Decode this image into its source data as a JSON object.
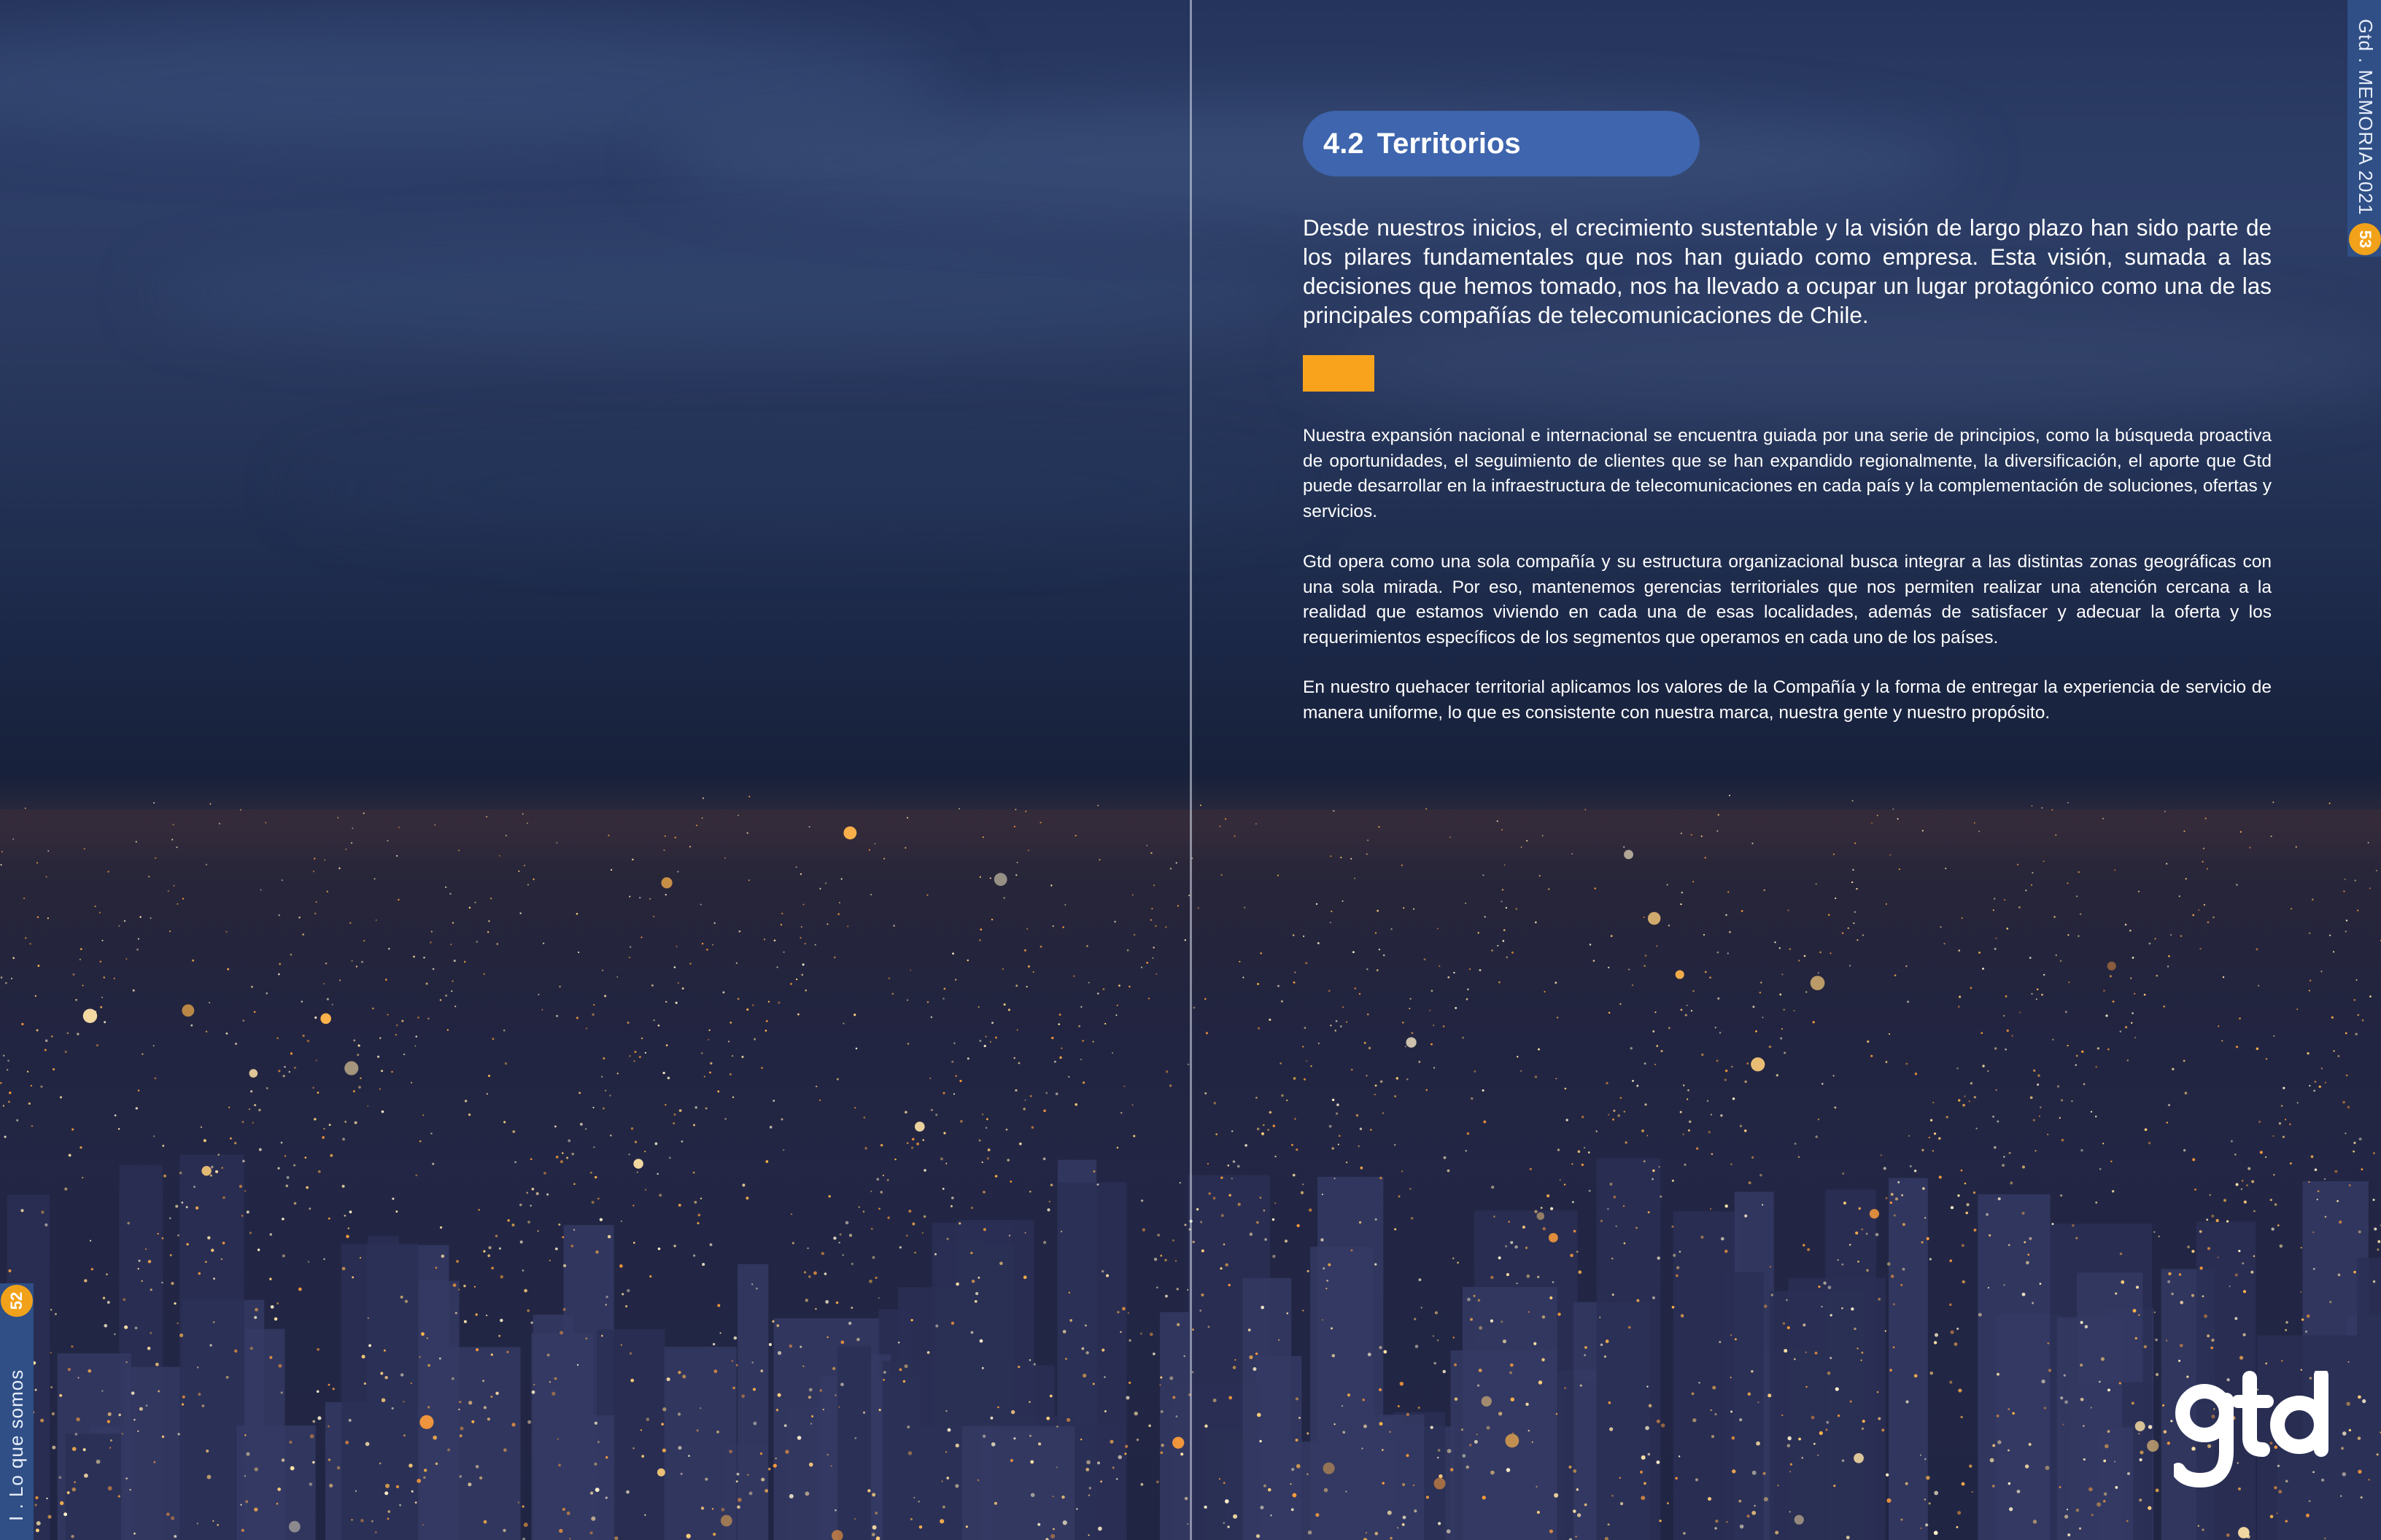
{
  "left_page": {
    "page_number": "52",
    "section_label": "I . Lo que somos"
  },
  "right_page": {
    "page_number": "53",
    "header_label": "Gtd . MEMORIA 2021",
    "section_number": "4.2",
    "section_title": "Territorios",
    "lead_paragraph": "Desde nuestros inicios, el crecimiento sustentable y la visión de largo plazo han sido parte de los pilares fundamentales que nos han guiado como empresa. Esta visión, sumada a las decisiones que hemos tomado, nos ha llevado a ocupar un lugar protagónico como una de las principales compañías de telecomunicaciones de Chile.",
    "paragraphs": [
      "Nuestra expansión nacional e internacional se encuentra guiada por una serie de principios, como la búsqueda proactiva de oportunidades, el seguimiento de clientes que se han expandido regionalmente, la diversificación, el aporte que Gtd puede desarrollar en la infraestructura de telecomunicaciones en cada país y la complementación de soluciones, ofertas y servicios.",
      "Gtd opera como una sola compañía y su estructura organizacional busca integrar a las distintas zonas geográficas con una sola mirada. Por eso, mantenemos gerencias territoriales que nos permiten realizar una atención cercana a la realidad que estamos viviendo en cada una de esas localidades, además de satisfacer y adecuar la oferta y los requerimientos específicos de los segmentos que operamos en cada uno de los países.",
      "En nuestro quehacer territorial aplicamos los valores de la Compañía y la forma de entregar la experiencia de servicio de manera uniforme, lo que es consistente con nuestra marca, nuestra gente y nuestro propósito."
    ],
    "logo_text": "gtd"
  },
  "colors": {
    "accent_orange": "#f8a31b",
    "title_pill_blue": "#3e65ad",
    "rail_blue": "#2f4f86"
  }
}
